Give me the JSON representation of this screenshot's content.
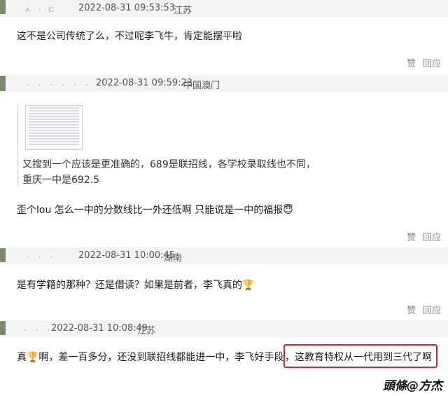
{
  "comments": [
    {
      "user": "ㅅ  ㆍ  ㄷ",
      "datetime": "2022-08-31 09:53:53",
      "location": "江苏",
      "text": "这不是公司传统了么，不过呢李飞牛，肯定能摆平啦",
      "like_label": "赞",
      "reply_label": "回应"
    },
    {
      "user": "ㆍ ㆍ ㆍ ㆍ ㆍ ㆍ ㆍ",
      "datetime": "2022-08-31 09:59:23",
      "location": "中国澳门",
      "quote_line1": "又搜到一个应该是更准确的，689是联招线，各学校录取线也不同，",
      "quote_line2": "重庆一中是692.5",
      "text": "歪个lou 怎么一中的分数线比一外还低啊 只能说是一中的福报😇",
      "like_label": "赞",
      "reply_label": "回应"
    },
    {
      "user": "ㆍ  ㆍ  ㆍ",
      "datetime": "2022-08-31 10:00:45",
      "location": "湖南",
      "text": "是有学籍的那种？还是借读？如果是前者，李飞真的🏆",
      "like_label": "赞",
      "reply_label": "回应"
    },
    {
      "user": "ㆍ ㆍ ㆍ",
      "datetime": "2022-08-31 10:08:49",
      "location": "江苏",
      "text_prefix": "真🏆啊，差一百多分，还没到联招线都能进一中，李飞好手段",
      "text_highlight": "，这教育特权从一代用到三代了啊",
      "like_label": "赞",
      "reply_label": "回应"
    }
  ],
  "watermark": "頭條@方杰",
  "colors": {
    "header_bg": "#f2f3f5",
    "highlight_border": "#d62a2a"
  }
}
